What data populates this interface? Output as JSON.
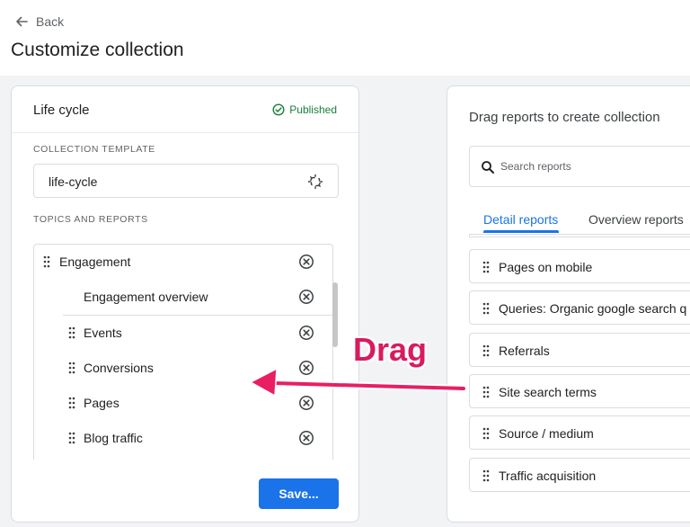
{
  "nav": {
    "back_label": "Back"
  },
  "page": {
    "title": "Customize collection"
  },
  "left_panel": {
    "title": "Life cycle",
    "status": "Published",
    "template_label": "COLLECTION TEMPLATE",
    "template_value": "life-cycle",
    "topics_label": "TOPICS AND REPORTS",
    "topic": "Engagement",
    "reports": [
      "Engagement overview",
      "Events",
      "Conversions",
      "Pages",
      "Blog traffic"
    ],
    "save_label": "Save..."
  },
  "right_panel": {
    "title": "Drag reports to create collection",
    "search_placeholder": "Search reports",
    "tabs": [
      "Detail reports",
      "Overview reports"
    ],
    "reports": [
      "Pages on mobile",
      "Queries: Organic google search q",
      "Referrals",
      "Site search terms",
      "Source / medium",
      "Traffic acquisition"
    ]
  },
  "annotation": {
    "text": "Drag"
  },
  "colors": {
    "accent": "#1a73e8",
    "published": "#188038",
    "annotation": "#d81b60",
    "border": "#dadce0",
    "background": "#f1f3f4"
  },
  "icons": {
    "back": "arrow-left-icon",
    "published": "check-circle-icon",
    "template": "unlink-icon",
    "drag": "drag-handle-icon",
    "remove": "remove-circle-icon",
    "search": "search-icon",
    "annotation": "arrow-left-annotation-icon"
  }
}
